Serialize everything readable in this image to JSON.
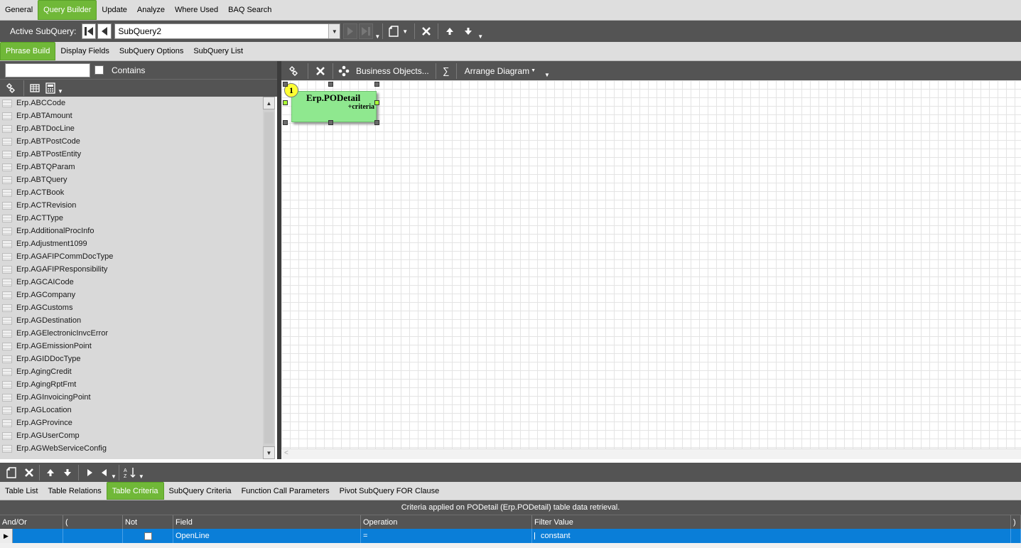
{
  "main_tabs": [
    "General",
    "Query Builder",
    "Update",
    "Analyze",
    "Where Used",
    "BAQ Search"
  ],
  "main_tab_active": "Query Builder",
  "subquery": {
    "label": "Active SubQuery:",
    "selected": "SubQuery2"
  },
  "sub_tabs": [
    "Phrase Build",
    "Display Fields",
    "SubQuery Options",
    "SubQuery List"
  ],
  "sub_tab_active": "Phrase Build",
  "table_search": {
    "value": "",
    "contains_label": "Contains",
    "contains_checked": false
  },
  "table_list": [
    "Erp.ABCCode",
    "Erp.ABTAmount",
    "Erp.ABTDocLine",
    "Erp.ABTPostCode",
    "Erp.ABTPostEntity",
    "Erp.ABTQParam",
    "Erp.ABTQuery",
    "Erp.ACTBook",
    "Erp.ACTRevision",
    "Erp.ACTType",
    "Erp.AdditionalProcInfo",
    "Erp.Adjustment1099",
    "Erp.AGAFIPCommDocType",
    "Erp.AGAFIPResponsibility",
    "Erp.AGCAICode",
    "Erp.AGCompany",
    "Erp.AGCustoms",
    "Erp.AGDestination",
    "Erp.AGElectronicInvcError",
    "Erp.AGEmissionPoint",
    "Erp.AGIDDocType",
    "Erp.AgingCredit",
    "Erp.AgingRptFmt",
    "Erp.AGInvoicingPoint",
    "Erp.AGLocation",
    "Erp.AGProvince",
    "Erp.AGUserComp",
    "Erp.AGWebServiceConfig"
  ],
  "diagram_toolbar": {
    "business_objects": "Business Objects...",
    "sum": "∑",
    "arrange": "Arrange Diagram"
  },
  "diagram_node": {
    "number": "1",
    "title": "Erp.PODetail",
    "subtitle": "+criteria",
    "color": "#8fe88f"
  },
  "bottom_tabs": [
    "Table List",
    "Table Relations",
    "Table Criteria",
    "SubQuery Criteria",
    "Function Call Parameters",
    "Pivot SubQuery FOR Clause"
  ],
  "bottom_tab_active": "Table Criteria",
  "criteria_caption": "Criteria applied on PODetail (Erp.PODetail)  table data retrieval.",
  "criteria_grid": {
    "columns": [
      "And/Or",
      "(",
      "Not",
      "Field",
      "Operation",
      "Filter Value",
      ")"
    ],
    "rows": [
      {
        "and_or": "",
        "open_paren": "",
        "not": false,
        "field": "OpenLine",
        "operation": "=",
        "filter_value": "constant",
        "close_paren": ""
      }
    ]
  },
  "colors": {
    "accent": "#70b838",
    "toolbar": "#545454",
    "selection": "#0a7ed8"
  }
}
